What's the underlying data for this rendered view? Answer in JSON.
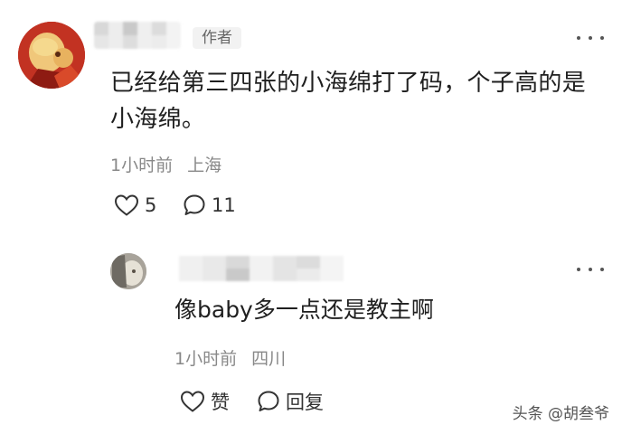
{
  "main_comment": {
    "author_tag": "作者",
    "text": "已经给第三四张的小海绵打了码，个子高的是小海绵。",
    "time": "1小时前",
    "location": "上海",
    "likes": "5",
    "replies": "11"
  },
  "reply": {
    "text": "像baby多一点还是教主啊",
    "time": "1小时前",
    "location": "四川",
    "like_label": "赞",
    "reply_label": "回复"
  },
  "watermark": "头条 @胡叁爷",
  "icons": {
    "more": "more-dots-icon",
    "like": "heart-icon",
    "comment": "comment-bubble-icon"
  }
}
